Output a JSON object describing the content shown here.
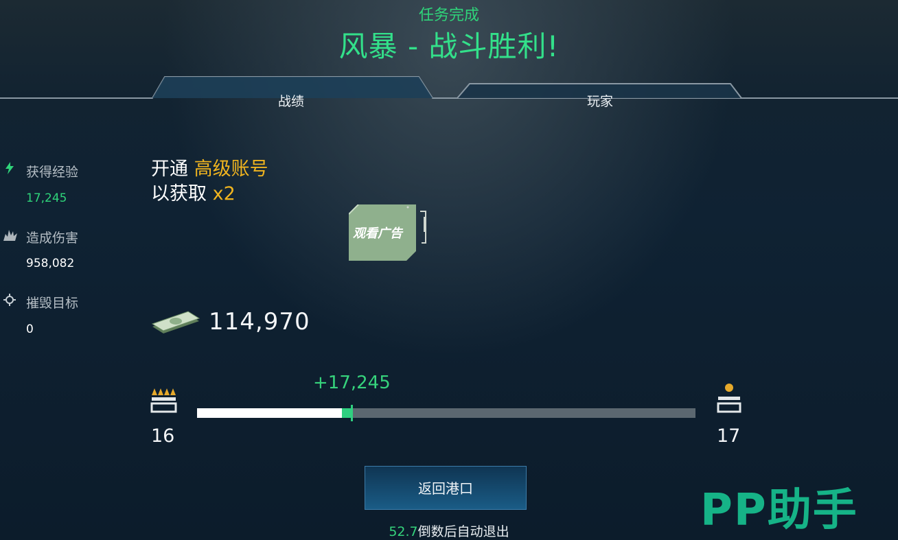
{
  "header": {
    "subtitle": "任务完成",
    "title": "风暴 - 战斗胜利!"
  },
  "tabs": [
    {
      "label": "战绩"
    },
    {
      "label": "玩家"
    }
  ],
  "stats": [
    {
      "icon": "lightning-icon",
      "label": "获得经验",
      "value": "17,245",
      "value_color": "#2fd47a"
    },
    {
      "icon": "explosion-icon",
      "label": "造成伤害",
      "value": "958,082",
      "value_color": "#ffffff"
    },
    {
      "icon": "crosshair-icon",
      "label": "摧毁目标",
      "value": "0",
      "value_color": "#ffffff"
    }
  ],
  "promo": {
    "line1_prefix": "开通 ",
    "line1_highlight": "高级账号",
    "line2_prefix": "以获取 ",
    "line2_highlight": "x2"
  },
  "ad_button": {
    "label": "观看广告"
  },
  "reward": {
    "money": "114,970",
    "icon": "cash-stack-icon"
  },
  "progress": {
    "gain_label": "+17,245",
    "before_fraction": 0.29,
    "after_fraction": 0.31
  },
  "rank": {
    "current": "16",
    "next": "17",
    "current_icon": "rank-chevrons-icon",
    "next_icon": "rank-star-icon"
  },
  "return_button": {
    "label": "返回港口"
  },
  "countdown": {
    "seconds": "52.7",
    "text": "倒数后自动退出"
  },
  "watermark": {
    "text": "PP助手"
  },
  "colors": {
    "accent": "#33e08a",
    "gold": "#f0b41f",
    "bar_track": "#5b6770",
    "button": "#1a5c86"
  }
}
